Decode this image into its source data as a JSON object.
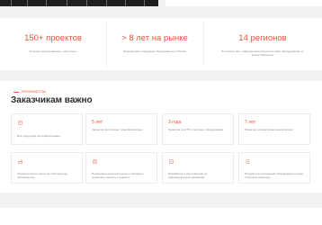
{
  "stats": [
    {
      "value": "150+ проектов",
      "desc": "Успешно реализованных «под ключ»"
    },
    {
      "value": "> 8 лет на рынке",
      "desc": "Производим и внедряем оборудование в России"
    },
    {
      "value": "14 регионов",
      "desc": "В которых мы с заводом выполнили поставки оборудования по всему Поволжью"
    }
  ],
  "advantages": {
    "eyebrow": "ПРЕИМУЩЕСТВА",
    "heading": "Заказчикам важно",
    "cards": [
      {
        "title": "",
        "icon": "certificate-icon",
        "text": "Вся продукция сертифицирована"
      },
      {
        "title": "5 лет",
        "icon": "",
        "text": "Гарантия на силовые трансформаторы"
      },
      {
        "title": "3 года",
        "icon": "",
        "text": "Гарантия на КТП и щитовое оборудование"
      },
      {
        "title": "7 лет",
        "icon": "",
        "text": "Гарантия на вакуумные выключатели"
      },
      {
        "title": "",
        "icon": "factory-icon",
        "text": "Сборка полного цикла на собственном производстве"
      },
      {
        "title": "",
        "icon": "components-icon",
        "text": "Передовые комплектующие и аппараты позволяют снизить стоимость"
      },
      {
        "title": "",
        "icon": "design-icon",
        "text": "Разработка и изготовление по индивидуальным размерам"
      },
      {
        "title": "",
        "icon": "document-icon",
        "text": "Разработка исполнений оборудования перед отгрузкой заказчику"
      }
    ]
  },
  "colors": {
    "accent": "#e8543a",
    "text": "#2b2b2b",
    "muted": "#8a8a8a",
    "background": "#f2f2f3"
  }
}
